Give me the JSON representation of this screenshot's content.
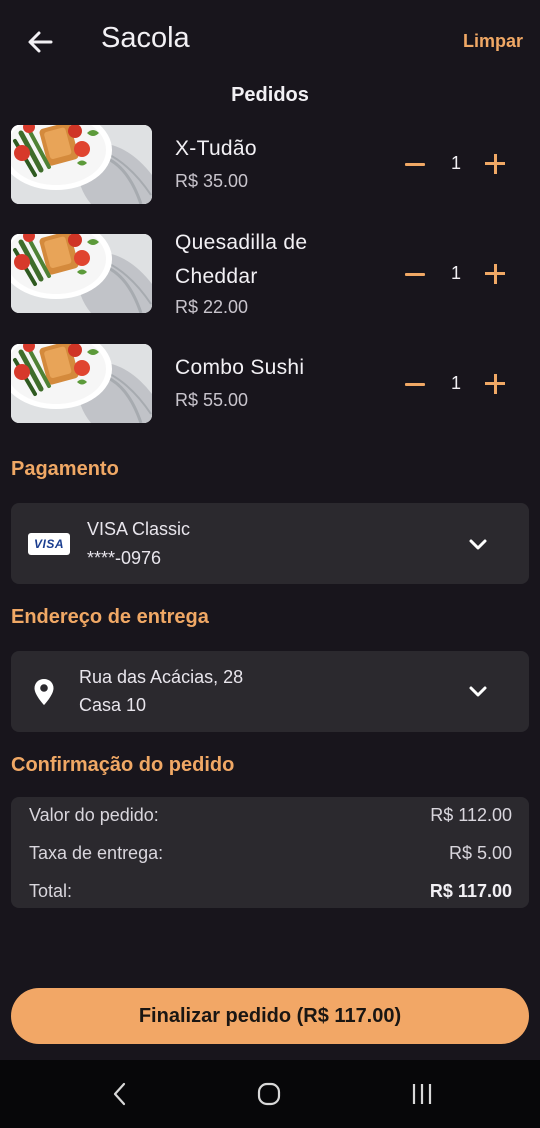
{
  "header": {
    "title": "Sacola",
    "clear_label": "Limpar"
  },
  "orders": {
    "section_title": "Pedidos",
    "items": [
      {
        "name": "X-Tudão",
        "price": "R$ 35.00",
        "quantity": "1"
      },
      {
        "name": "Quesadilla de Cheddar",
        "price": "R$ 22.00",
        "quantity": "1"
      },
      {
        "name": "Combo Sushi",
        "price": "R$ 55.00",
        "quantity": "1"
      }
    ]
  },
  "payment": {
    "section_title": "Pagamento",
    "card_brand": "VISA",
    "card_name": "VISA Classic",
    "card_number": "****-0976"
  },
  "address": {
    "section_title": "Endereço de entrega",
    "street": "Rua das Acácias, 28",
    "complement": "Casa 10"
  },
  "confirmation": {
    "section_title": "Confirmação do pedido",
    "rows": [
      {
        "label": "Valor do pedido:",
        "value": "R$ 112.00"
      },
      {
        "label": "Taxa de entrega:",
        "value": "R$ 5.00"
      },
      {
        "label": "Total:",
        "value": "R$ 117.00"
      }
    ]
  },
  "checkout": {
    "button_label": "Finalizar pedido (R$ 117.00)"
  },
  "icons": {
    "back": "arrow-left-icon",
    "decrease": "minus-icon",
    "increase": "plus-icon",
    "expand": "chevron-down-icon",
    "location": "map-pin-icon"
  },
  "colors": {
    "background": "#18151c",
    "accent": "#f0a865",
    "card": "#2b292e",
    "button": "#f2a766"
  }
}
